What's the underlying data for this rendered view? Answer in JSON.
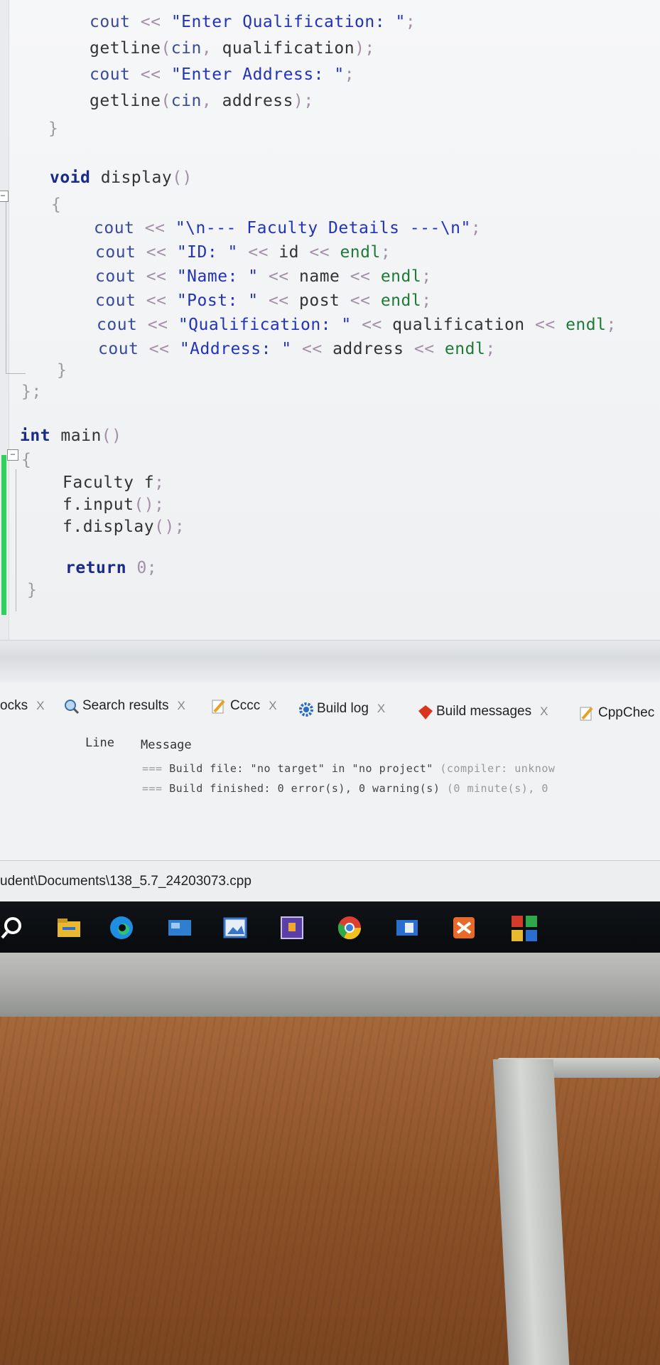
{
  "editor": {
    "lines": [
      {
        "id": "l1",
        "text": "cout << \"Enter Qualification: \";"
      },
      {
        "id": "l2",
        "text": "getline(cin, qualification);"
      },
      {
        "id": "l3",
        "text": "cout << \"Enter Address: \";"
      },
      {
        "id": "l4",
        "text": "getline(cin, address);"
      },
      {
        "id": "l5",
        "text": "}"
      },
      {
        "id": "l6",
        "text": "void display()"
      },
      {
        "id": "l7",
        "text": "{"
      },
      {
        "id": "l8",
        "text": "cout << \"\\n--- Faculty Details ---\\n\";"
      },
      {
        "id": "l9",
        "text": "cout << \"ID: \" << id << endl;"
      },
      {
        "id": "l10",
        "text": "cout << \"Name: \" << name << endl;"
      },
      {
        "id": "l11",
        "text": "cout << \"Post: \" << post << endl;"
      },
      {
        "id": "l12",
        "text": "cout << \"Qualification: \" << qualification << endl;"
      },
      {
        "id": "l13",
        "text": "cout << \"Address: \" << address << endl;"
      },
      {
        "id": "l14",
        "text": "}"
      },
      {
        "id": "l15",
        "text": "};"
      },
      {
        "id": "l16",
        "text": "int main()"
      },
      {
        "id": "l17",
        "text": "{"
      },
      {
        "id": "l18",
        "text": "Faculty f;"
      },
      {
        "id": "l19",
        "text": "f.input();"
      },
      {
        "id": "l20",
        "text": "f.display();"
      },
      {
        "id": "l21",
        "text": "return 0;"
      },
      {
        "id": "l22",
        "text": "}"
      }
    ]
  },
  "logs_panel": {
    "tabs": [
      {
        "label": "ocks",
        "icon": "none"
      },
      {
        "label": "Search results",
        "icon": "magnifier-icon"
      },
      {
        "label": "Cccc",
        "icon": "pencil-icon"
      },
      {
        "label": "Build log",
        "icon": "gear-icon"
      },
      {
        "label": "Build messages",
        "icon": "red-diamond-icon"
      },
      {
        "label": "CppChec",
        "icon": "pencil-icon"
      }
    ],
    "close_glyph": "X",
    "columns": {
      "line": "Line",
      "message": "Message"
    },
    "messages": [
      {
        "prefix": "===",
        "text": " Build file: \"no target\" in \"no project\" ",
        "muted": "(compiler: unknow"
      },
      {
        "prefix": "===",
        "text": " Build finished: 0 error(s), 0 warning(s) ",
        "muted": "(0 minute(s), 0"
      }
    ]
  },
  "statusbar": {
    "path": "udent\\Documents\\138_5.7_24203073.cpp"
  },
  "taskbar": {
    "icons": [
      {
        "name": "search-circle-icon",
        "color": "#ffffff"
      },
      {
        "name": "file-explorer-icon",
        "color": "#e8b830"
      },
      {
        "name": "edge-icon",
        "color": "#1e8fe0"
      },
      {
        "name": "app-blue-icon",
        "color": "#2f7fd0"
      },
      {
        "name": "photo-app-icon",
        "color": "#3a76c8"
      },
      {
        "name": "purple-app-icon",
        "color": "#5b3fa8"
      },
      {
        "name": "chrome-icon",
        "color": "#e2a62a"
      },
      {
        "name": "blue-square-icon",
        "color": "#2a6fcf"
      },
      {
        "name": "orange-app-icon",
        "color": "#e86a2a"
      },
      {
        "name": "codeblocks-icon",
        "color": "#d23b2b"
      }
    ]
  },
  "colors": {
    "keyword": "#1a2a88",
    "string": "#2233bb",
    "operator": "#a48fa8",
    "endl": "#1f7a3a",
    "change_bar": "#2ed15a"
  }
}
